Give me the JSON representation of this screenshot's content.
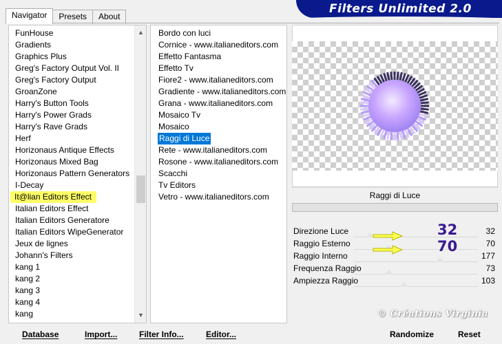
{
  "window_title": "Filters Unlimited 2.0",
  "tabs": [
    {
      "label": "Navigator",
      "active": true
    },
    {
      "label": "Presets",
      "active": false
    },
    {
      "label": "About",
      "active": false
    }
  ],
  "categories": [
    "FunHouse",
    "Gradients",
    "Graphics Plus",
    "Greg's Factory Output Vol. II",
    "Greg's Factory Output",
    "GroanZone",
    "Harry's Button Tools",
    "Harry's Power Grads",
    "Harry's Rave Grads",
    "Herf",
    "Horizonaus Antique Effects",
    "Horizonaus Mixed Bag",
    "Horizonaus Pattern Generators",
    "I-Decay",
    "It@lian Editors Effect",
    "Italian Editors Effect",
    "Italian Editors Generatore",
    "Italian Editors WipeGenerator",
    "Jeux de lignes",
    "Johann's Filters",
    "kang 1",
    "kang 2",
    "kang 3",
    "kang 4",
    "kang"
  ],
  "highlighted_category": "It@lian Editors Effect",
  "filters": [
    "Bordo con luci",
    "Cornice - www.italianeditors.com",
    "Effetto Fantasma",
    "Effetto Tv",
    "Fiore2 - www.italianeditors.com",
    "Gradiente - www.italianeditors.com",
    "Grana - www.italianeditors.com",
    "Mosaico Tv",
    "Mosaico",
    "Raggi di Luce",
    "Rete - www.italianeditors.com",
    "Rosone - www.italianeditors.com",
    "Scacchi",
    "Tv Editors",
    "Vetro - www.italianeditors.com"
  ],
  "selected_filter": "Raggi di Luce",
  "filter_title": "Raggi di Luce",
  "parameters": [
    {
      "label": "Direzione Luce",
      "value": "32",
      "fraction": 0.126
    },
    {
      "label": "Raggio Esterno",
      "value": "70",
      "fraction": 0.275
    },
    {
      "label": "Raggio Interno",
      "value": "177",
      "fraction": 0.694
    },
    {
      "label": "Frequenza Raggio",
      "value": "73",
      "fraction": 0.286
    },
    {
      "label": "Ampiezza Raggio",
      "value": "103",
      "fraction": 0.404
    }
  ],
  "annotations": {
    "first": "32",
    "second": "70"
  },
  "watermark": "© Créations Virginia",
  "buttons": {
    "database": "Database",
    "import": "Import...",
    "filter_info": "Filter Info...",
    "editor": "Editor...",
    "randomize": "Randomize",
    "reset": "Reset"
  },
  "colors": {
    "banner": "#0a1a8c",
    "selection": "#0078d7",
    "highlight": "#ffff66",
    "annotation": "#3a1a90",
    "arrow": "#ffff55"
  }
}
